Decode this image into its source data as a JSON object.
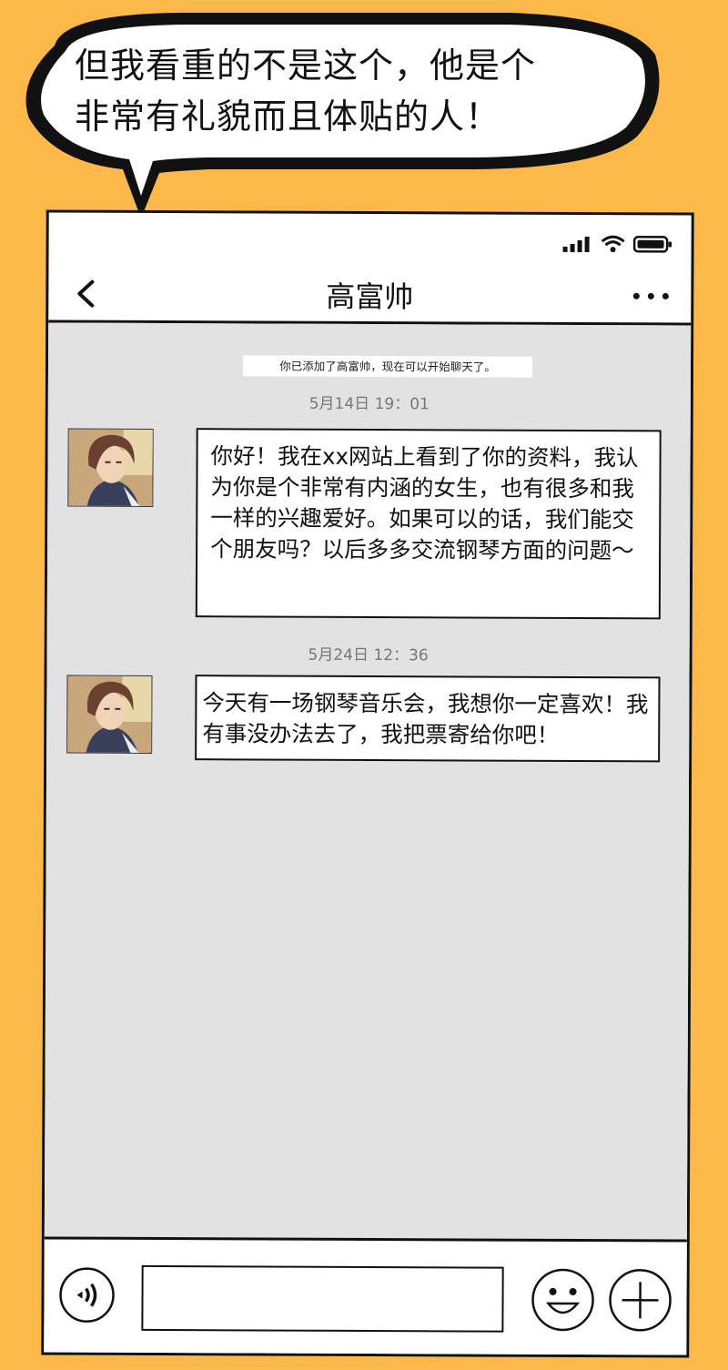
{
  "caption": {
    "line1": "但我看重的不是这个，他是个",
    "line2": "非常有礼貌而且体贴的人！"
  },
  "header": {
    "title": "高富帅"
  },
  "chat": {
    "system_notice": "你已添加了高富帅，现在可以开始聊天了。",
    "messages": [
      {
        "timestamp": "5月14日 19：01",
        "text": "你好！我在xx网站上看到了你的资料，我认为你是个非常有内涵的女生，也有很多和我一样的兴趣爱好。如果可以的话，我们能交个朋友吗？以后多多交流钢琴方面的问题～"
      },
      {
        "timestamp": "5月24日 12：36",
        "text": "今天有一场钢琴音乐会，我想你一定喜欢！我有事没办法去了，我把票寄给你吧！"
      }
    ]
  },
  "input": {
    "value": "",
    "placeholder": ""
  },
  "colors": {
    "background": "#FDB84A",
    "chat_bg": "#E2E2E2",
    "timestamp": "#777777"
  },
  "icons": [
    "signal-icon",
    "wifi-icon",
    "battery-icon",
    "back-arrow-icon",
    "more-icon",
    "voice-icon",
    "emoji-icon",
    "plus-icon"
  ]
}
